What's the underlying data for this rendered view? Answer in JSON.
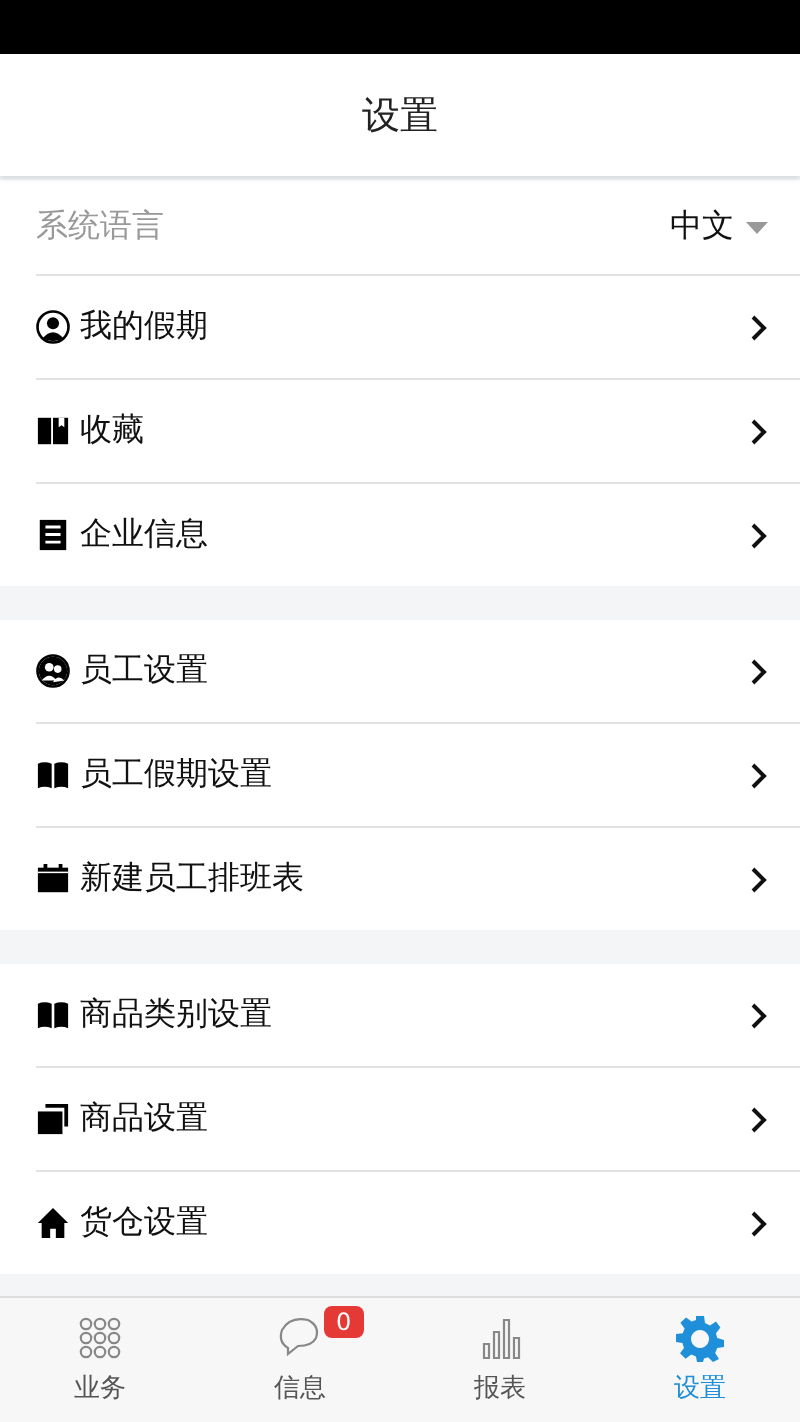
{
  "header": {
    "title": "设置"
  },
  "language": {
    "label": "系统语言",
    "value": "中文"
  },
  "groups": [
    {
      "items": [
        {
          "kind": "person",
          "label": "我的假期"
        },
        {
          "kind": "book",
          "label": "收藏"
        },
        {
          "kind": "document",
          "label": "企业信息"
        }
      ]
    },
    {
      "items": [
        {
          "kind": "people",
          "label": "员工设置"
        },
        {
          "kind": "openbook",
          "label": "员工假期设置"
        },
        {
          "kind": "calendar",
          "label": "新建员工排班表"
        }
      ]
    },
    {
      "items": [
        {
          "kind": "openbook",
          "label": "商品类别设置"
        },
        {
          "kind": "copy",
          "label": "商品设置"
        },
        {
          "kind": "home",
          "label": "货仓设置"
        }
      ]
    }
  ],
  "tabs": [
    {
      "kind": "grid",
      "label": "业务",
      "selected": false
    },
    {
      "kind": "chat",
      "label": "信息",
      "selected": false,
      "badge": "0"
    },
    {
      "kind": "chart",
      "label": "报表",
      "selected": false
    },
    {
      "kind": "gear",
      "label": "设置",
      "selected": true
    }
  ]
}
